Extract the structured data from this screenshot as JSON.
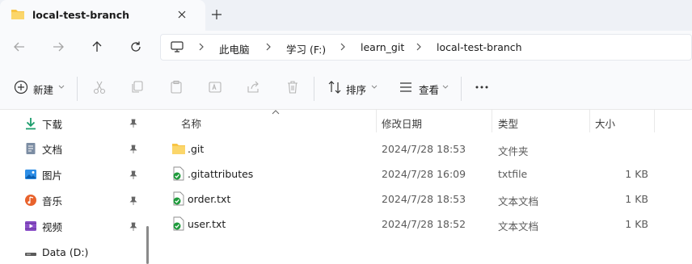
{
  "tab": {
    "title": "local-test-branch"
  },
  "breadcrumb": [
    "此电脑",
    "学习 (F:)",
    "learn_git",
    "local-test-branch"
  ],
  "toolbar": {
    "new_label": "新建",
    "sort_label": "排序",
    "view_label": "查看"
  },
  "sidebar": {
    "items": [
      {
        "label": "下载",
        "icon": "download-icon",
        "pinned": true
      },
      {
        "label": "文档",
        "icon": "document-icon",
        "pinned": true
      },
      {
        "label": "图片",
        "icon": "pictures-icon",
        "pinned": true
      },
      {
        "label": "音乐",
        "icon": "music-icon",
        "pinned": true
      },
      {
        "label": "视频",
        "icon": "video-icon",
        "pinned": true
      },
      {
        "label": "Data (D:)",
        "icon": "drive-icon",
        "pinned": false
      }
    ]
  },
  "columns": {
    "name": "名称",
    "date": "修改日期",
    "type": "类型",
    "size": "大小"
  },
  "files": [
    {
      "name": ".git",
      "date": "2024/7/28 18:53",
      "type": "文件夹",
      "size": "",
      "icon": "folder-icon"
    },
    {
      "name": ".gitattributes",
      "date": "2024/7/28 16:09",
      "type": "txtfile",
      "size": "1 KB",
      "icon": "text-file-icon"
    },
    {
      "name": "order.txt",
      "date": "2024/7/28 18:53",
      "type": "文本文档",
      "size": "1 KB",
      "icon": "text-file-icon"
    },
    {
      "name": "user.txt",
      "date": "2024/7/28 18:52",
      "type": "文本文档",
      "size": "1 KB",
      "icon": "text-file-icon"
    }
  ],
  "colors": {
    "accent": "#0067c0",
    "folder": "#f8c444",
    "tabbar": "#eef1f6"
  }
}
